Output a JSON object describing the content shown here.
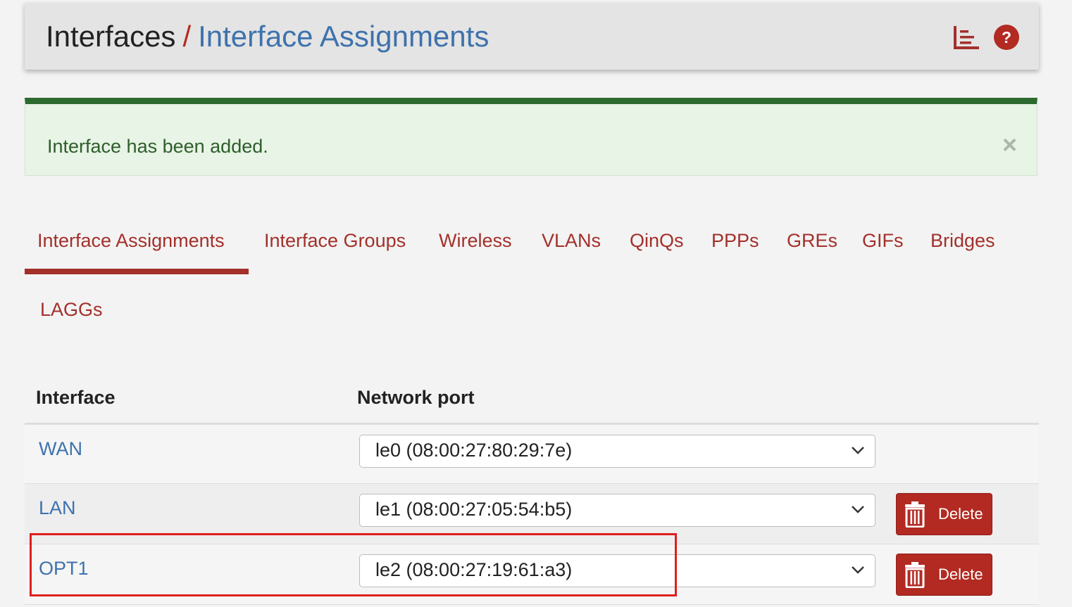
{
  "breadcrumb": {
    "parent": "Interfaces",
    "separator": "/",
    "current": "Interface Assignments"
  },
  "header_icons": [
    "chart-icon",
    "help-icon"
  ],
  "alert": {
    "message": "Interface has been added.",
    "close": "×"
  },
  "tabs": [
    {
      "label": "Interface Assignments",
      "active": true
    },
    {
      "label": "Interface Groups"
    },
    {
      "label": "Wireless"
    },
    {
      "label": "VLANs"
    },
    {
      "label": "QinQs"
    },
    {
      "label": "PPPs"
    },
    {
      "label": "GREs"
    },
    {
      "label": "GIFs"
    },
    {
      "label": "Bridges"
    },
    {
      "label": "LAGGs"
    }
  ],
  "table": {
    "headers": {
      "interface": "Interface",
      "network_port": "Network port"
    },
    "rows": [
      {
        "interface": "WAN",
        "port": "le0 (08:00:27:80:29:7e)"
      },
      {
        "interface": "LAN",
        "port": "le1 (08:00:27:05:54:b5)",
        "action": "Delete"
      },
      {
        "interface": "OPT1",
        "port": "le2 (08:00:27:19:61:a3)",
        "action": "Delete"
      }
    ]
  },
  "colors": {
    "accent": "#a3302b",
    "link": "#3e72ad",
    "success_bar": "#2d6a2f",
    "success_bg": "#e8f4e6",
    "delete_button": "#b22a22",
    "highlight_box": "#e01e1e"
  }
}
